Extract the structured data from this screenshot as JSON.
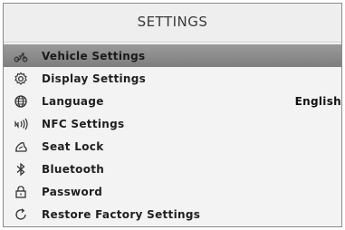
{
  "header": {
    "title": "SETTINGS"
  },
  "menu": {
    "items": [
      {
        "label": "Vehicle Settings",
        "icon": "scooter-icon",
        "selected": true
      },
      {
        "label": "Display Settings",
        "icon": "gear-icon"
      },
      {
        "label": "Language",
        "icon": "globe-icon",
        "value": "English"
      },
      {
        "label": "NFC Settings",
        "icon": "nfc-icon"
      },
      {
        "label": "Seat Lock",
        "icon": "seat-icon"
      },
      {
        "label": "Bluetooth",
        "icon": "bluetooth-icon"
      },
      {
        "label": "Password",
        "icon": "lock-icon"
      },
      {
        "label": "Restore Factory Settings",
        "icon": "restore-icon"
      }
    ]
  },
  "colors": {
    "selected_row": "#8c8c8c",
    "background": "#f3f3f3",
    "text": "#1f1f1f"
  }
}
